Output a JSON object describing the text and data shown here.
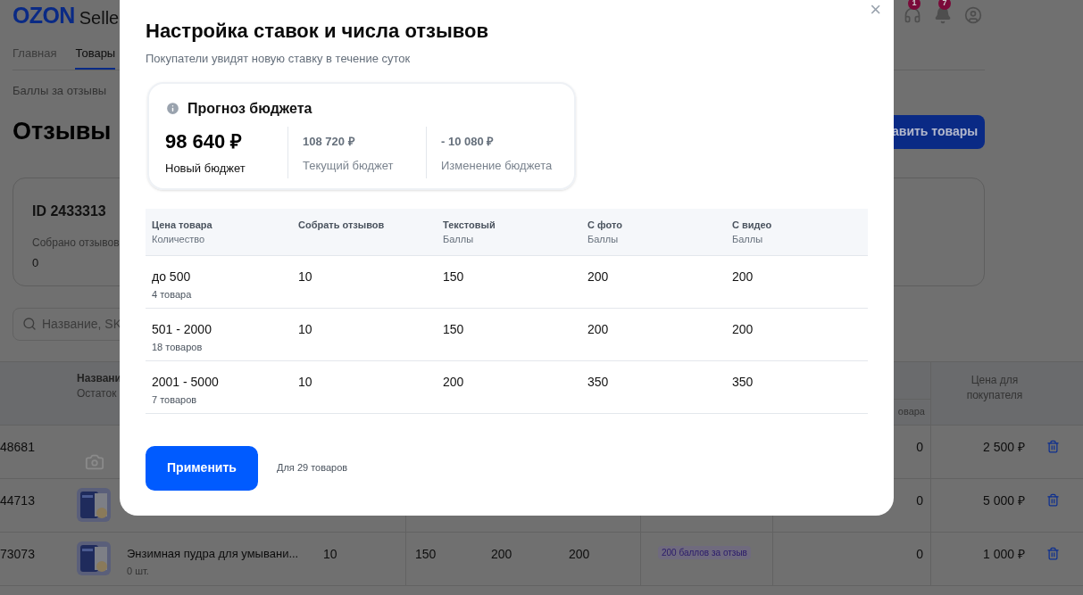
{
  "header": {
    "logo": "OZON",
    "brand_suffix": "Selle",
    "support_badge": "1",
    "notifications_badge": "7"
  },
  "nav": {
    "tabs": [
      {
        "label": "Главная",
        "selected": false
      },
      {
        "label": "Товары",
        "selected": true
      }
    ]
  },
  "breadcrumb": "Баллы за отзывы",
  "page_title": "Отзывы",
  "add_button": "авить товары",
  "summary_card": {
    "id": "ID 2433313",
    "label": "Собрано отзывов",
    "value": "0"
  },
  "search": {
    "placeholder": "Название, SK"
  },
  "table": {
    "header": {
      "name": "Названи",
      "stock": "Остаток",
      "column_9": "овара",
      "price": "Цена для покупателя"
    },
    "rows": [
      {
        "sku": "48681",
        "thumbnail": {
          "kind": "placeholder"
        },
        "count": "0",
        "price": "2 500 ₽"
      },
      {
        "sku": "44713",
        "count": "0",
        "price": "5 000 ₽"
      },
      {
        "sku": "73073",
        "name": "Энзимная пудра для умывани...",
        "stock": "0 шт.",
        "collect": "10",
        "text": "150",
        "photo": "200",
        "video": "200",
        "badge": "200 баллов за отзыв",
        "count": "0",
        "price": "1 000 ₽"
      }
    ]
  },
  "modal": {
    "title": "Настройка ставок и числа отзывов",
    "subtitle": "Покупатели увидят новую ставку в течение суток",
    "close": "×",
    "budget": {
      "title": "Прогноз бюджета",
      "new": {
        "value": "98 640 ₽",
        "label": "Новый бюджет"
      },
      "current": {
        "value": "108 720 ₽",
        "label": "Текущий бюджет"
      },
      "change": {
        "value": "- 10 080 ₽",
        "label": "Изменение бюджета"
      }
    },
    "table": {
      "columns": [
        {
          "title": "Цена товара",
          "sub": "Количество"
        },
        {
          "title": "Собрать отзывов"
        },
        {
          "title": "Текстовый",
          "sub": "Баллы"
        },
        {
          "title": "С фото",
          "sub": "Баллы"
        },
        {
          "title": "С видео",
          "sub": "Баллы"
        }
      ],
      "rows": [
        {
          "cells": [
            {
              "text": "до 500",
              "sub": "4 товара"
            },
            {
              "text": "10"
            },
            {
              "text": "150"
            },
            {
              "text": "200"
            },
            {
              "text": "200"
            }
          ]
        },
        {
          "cells": [
            {
              "text": "501 - 2000",
              "sub": "18 товаров"
            },
            {
              "text": "10"
            },
            {
              "text": "150"
            },
            {
              "text": "200"
            },
            {
              "text": "200"
            }
          ]
        },
        {
          "cells": [
            {
              "text": "2001 - 5000",
              "sub": "7 товаров"
            },
            {
              "text": "10"
            },
            {
              "text": "200"
            },
            {
              "text": "350"
            },
            {
              "text": "350"
            }
          ]
        }
      ]
    },
    "apply_button": "Применить",
    "note": "Для 29 товаров"
  }
}
